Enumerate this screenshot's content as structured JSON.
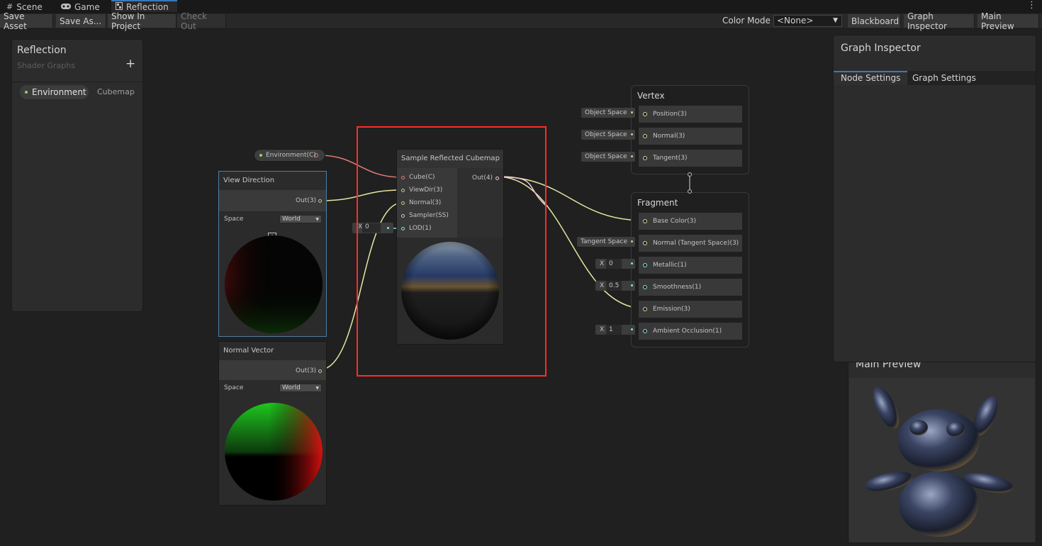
{
  "tabs": [
    {
      "label": "Scene",
      "icon": "grid-icon"
    },
    {
      "label": "Game",
      "icon": "gamepad-icon"
    },
    {
      "label": "Reflection",
      "icon": "shader-graph-icon"
    }
  ],
  "menu_icon": "⋮",
  "toolbar": {
    "save_asset": "Save Asset",
    "save_as": "Save As...",
    "show_in_project": "Show In Project",
    "check_out": "Check Out",
    "color_mode_label": "Color Mode",
    "color_mode_value": "<None>",
    "blackboard": "Blackboard",
    "graph_inspector": "Graph Inspector",
    "main_preview": "Main Preview"
  },
  "blackboard": {
    "title": "Reflection",
    "subtitle": "Shader Graphs",
    "add": "+",
    "properties": [
      {
        "name": "Environment",
        "type": "Cubemap"
      }
    ]
  },
  "nodes": {
    "environment_prop": {
      "label": "Environment(C)"
    },
    "view_direction": {
      "title": "View Direction",
      "output": "Out(3)",
      "space_label": "Space",
      "space_value": "World",
      "collapse": "^"
    },
    "normal_vector": {
      "title": "Normal Vector",
      "output": "Out(3)",
      "space_label": "Space",
      "space_value": "World"
    },
    "sample_cubemap": {
      "title": "Sample Reflected Cubemap",
      "inputs": [
        "Cube(C)",
        "ViewDir(3)",
        "Normal(3)",
        "Sampler(SS)",
        "LOD(1)"
      ],
      "output": "Out(4)",
      "lod_prefix": "X",
      "lod_value": "0"
    }
  },
  "vertex": {
    "title": "Vertex",
    "blocks": [
      {
        "label": "Position(3)",
        "input": "Object Space"
      },
      {
        "label": "Normal(3)",
        "input": "Object Space"
      },
      {
        "label": "Tangent(3)",
        "input": "Object Space"
      }
    ]
  },
  "fragment": {
    "title": "Fragment",
    "blocks": [
      {
        "label": "Base Color(3)",
        "input": ""
      },
      {
        "label": "Normal (Tangent Space)(3)",
        "input": "Tangent Space"
      },
      {
        "label": "Metallic(1)",
        "input": "0"
      },
      {
        "label": "Smoothness(1)",
        "input": "0.5"
      },
      {
        "label": "Emission(3)",
        "input": ""
      },
      {
        "label": "Ambient Occlusion(1)",
        "input": "1"
      }
    ],
    "x_prefix": "X"
  },
  "inspector": {
    "title": "Graph Inspector",
    "tab_node": "Node Settings",
    "tab_graph": "Graph Settings"
  },
  "main_preview": {
    "title": "Main Preview"
  },
  "colors": {
    "accent": "#3a79bb",
    "highlight": "#ff2b2b",
    "edge_vector3": "#e7e7a0",
    "edge_vector4": "#f0c6e0",
    "edge_cubemap": "#e07a7a",
    "edge_float": "#84e4e7"
  }
}
